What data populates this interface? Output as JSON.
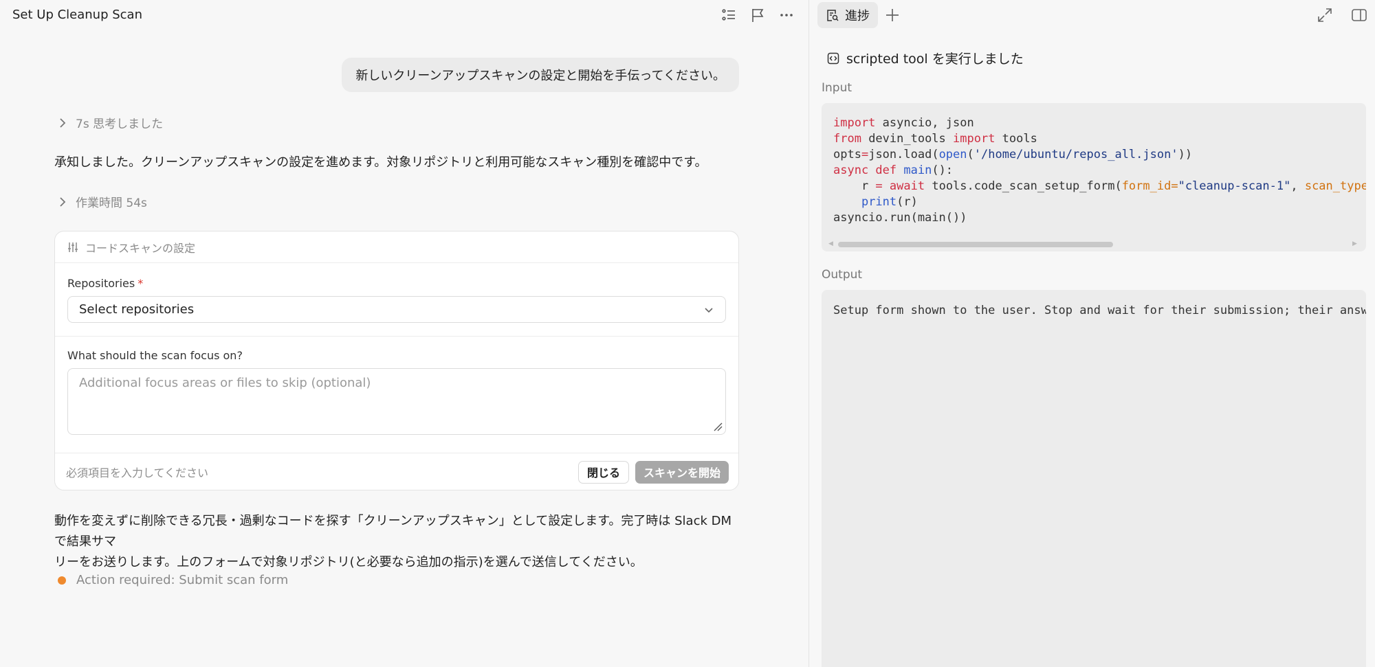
{
  "left": {
    "title": "Set Up Cleanup Scan",
    "user_message": "新しいクリーンアップスキャンの設定と開始を手伝ってください。",
    "thought_label": "7s 思考しました",
    "ack_text": "承知しました。クリーンアップスキャンの設定を進めます。対象リポジトリと利用可能なスキャン種別を確認中です。",
    "work_label": "作業時間 54s",
    "form": {
      "header": "コードスキャンの設定",
      "repos_label": "Repositories",
      "repos_required": "*",
      "repos_value": "Select repositories",
      "focus_label": "What should the scan focus on?",
      "focus_placeholder": "Additional focus areas or files to skip (optional)",
      "footer_hint": "必須項目を入力してください",
      "close_button": "閉じる",
      "start_button": "スキャンを開始"
    },
    "summary_line1": "動作を変えずに削除できる冗長・過剰なコードを探す「クリーンアップスキャン」として設定します。完了時は Slack DM で結果サマ",
    "summary_line2": "リーをお送りします。上のフォームで対象リポジトリ(と必要なら追加の指示)を選んで送信してください。",
    "action_status": "Action required: Submit scan form"
  },
  "right": {
    "tab_label": "進捗",
    "tool_title": "scripted tool を実行しました",
    "input_label": "Input",
    "output_label": "Output",
    "code": {
      "l1_kw": "import",
      "l1_rest": " asyncio, json",
      "l2_kw1": "from",
      "l2_mid": " devin_tools ",
      "l2_kw2": "import",
      "l2_rest": " tools",
      "l3_a": "opts",
      "l3_eq": "=",
      "l3_b": "json.load(",
      "l3_fn": "open",
      "l3_c": "(",
      "l3_str": "'/home/ubuntu/repos_all.json'",
      "l3_d": "))",
      "l4_kw": "async def",
      "l4_sp": " ",
      "l4_fn": "main",
      "l4_rest": "():",
      "l5_indent": "    r ",
      "l5_eq": "=",
      "l5_sp": " ",
      "l5_kw": "await",
      "l5_mid": " tools.code_scan_setup_form(",
      "l5_p1": "form_id=",
      "l5_s1": "\"cleanup-scan-1\"",
      "l5_comma": ", ",
      "l5_p2": "scan_type",
      "l6_indent": "    ",
      "l6_fn": "print",
      "l6_rest": "(r)",
      "l7": "asyncio.run(main())"
    },
    "output_text": "Setup form shown to the user. Stop and wait for their submission; their answ"
  }
}
